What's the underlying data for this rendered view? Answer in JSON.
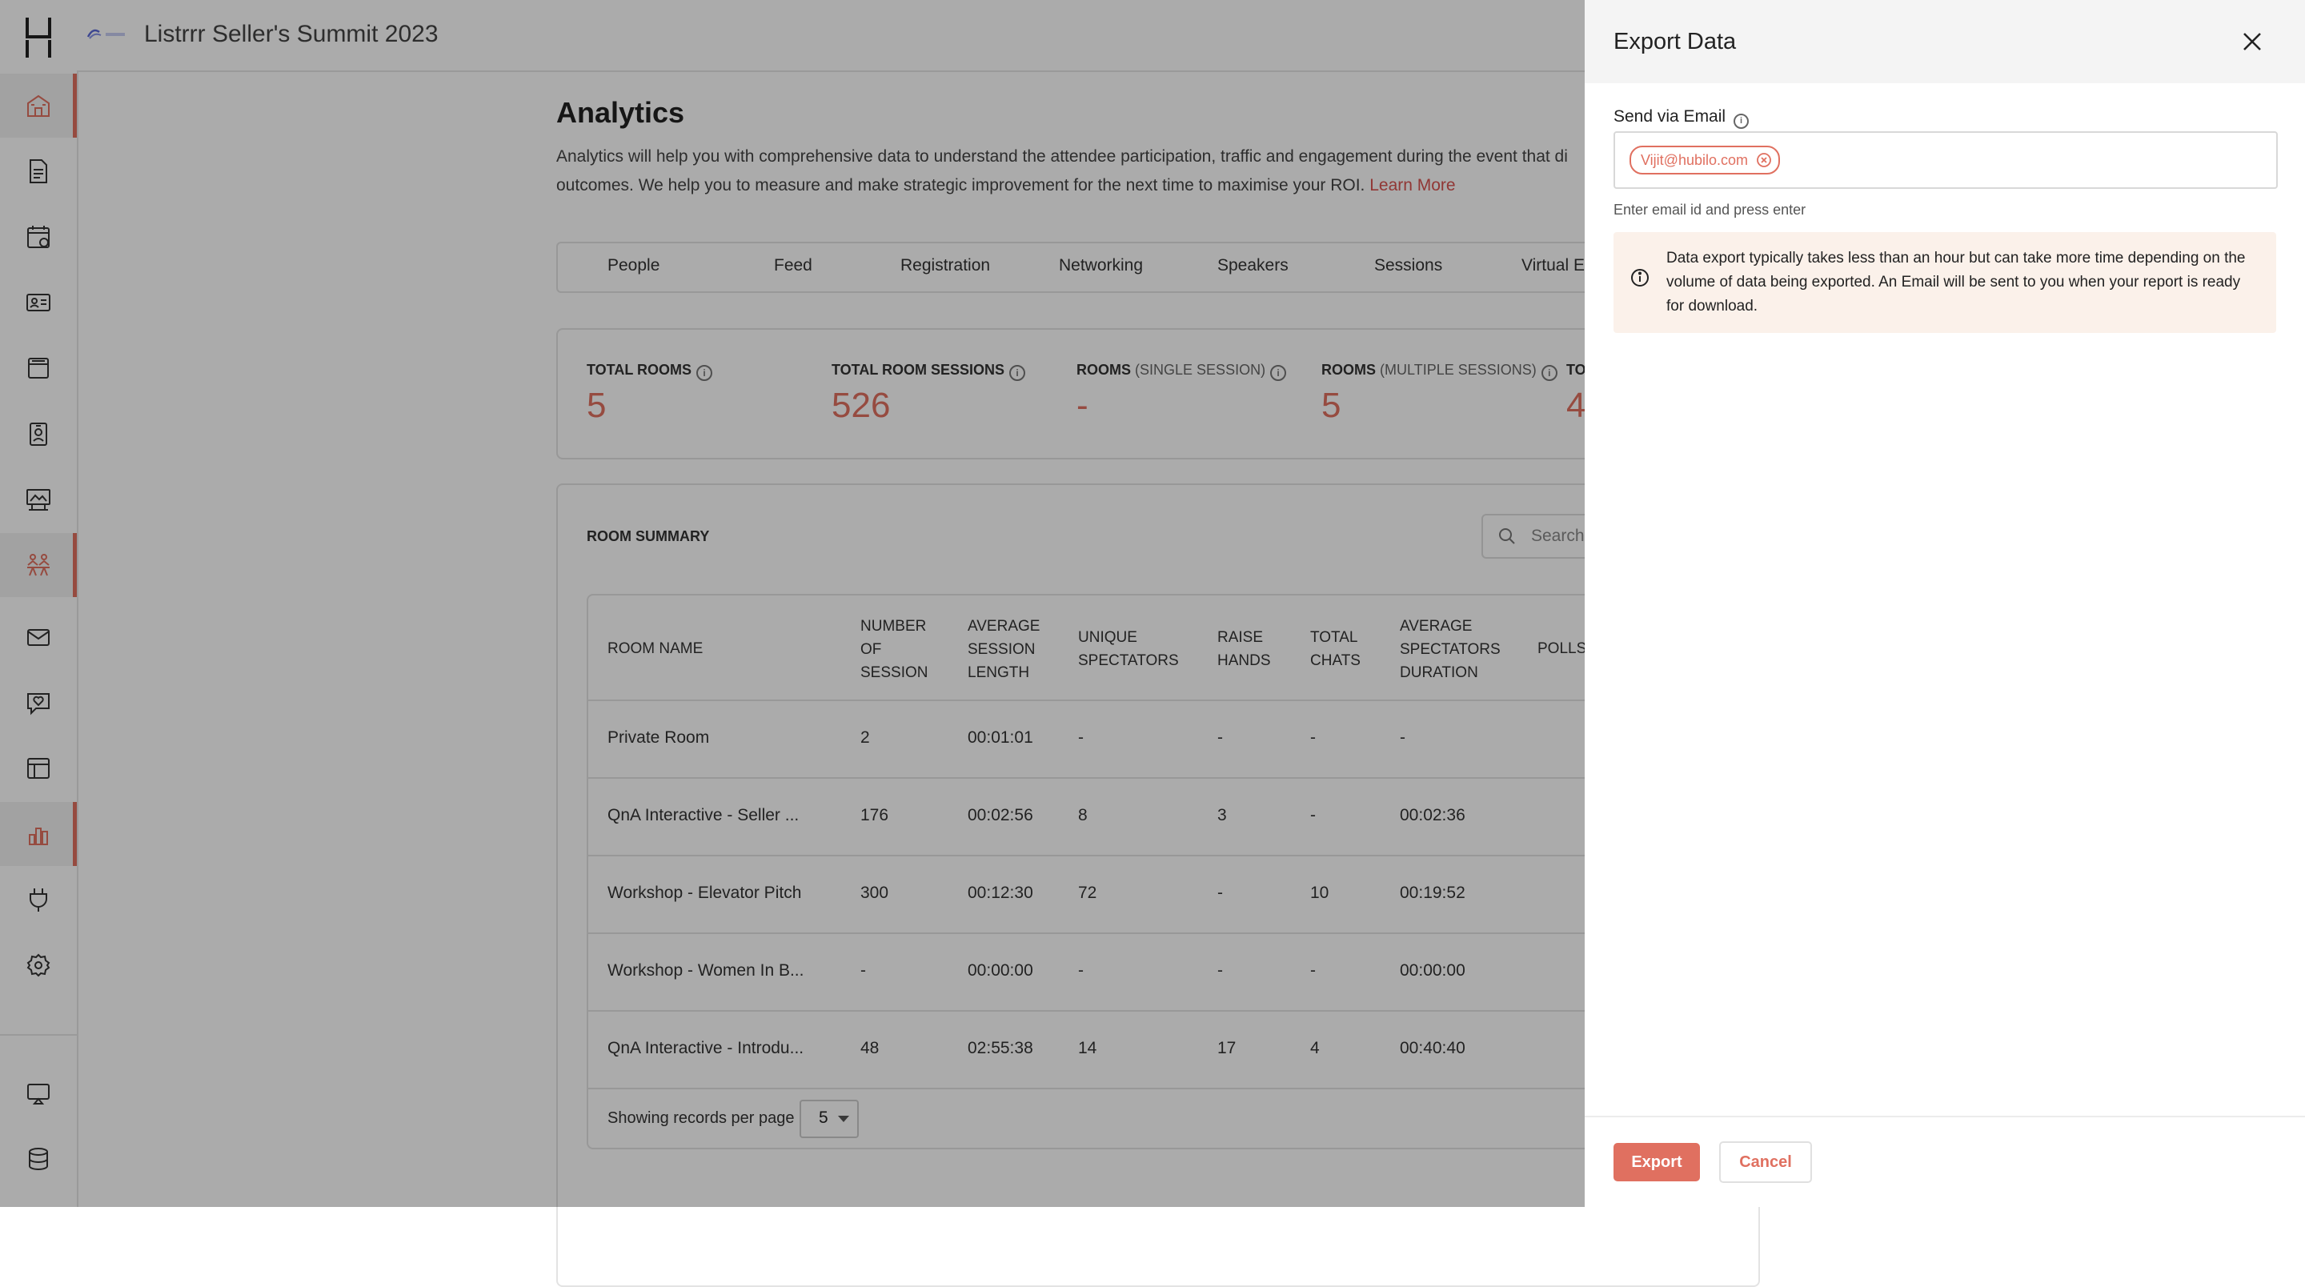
{
  "header": {
    "event_title": "Listrrr Seller's Summit 2023"
  },
  "sidebar": {
    "items": [
      {
        "icon": "home-icon",
        "active": true
      },
      {
        "icon": "document-icon",
        "active": false
      },
      {
        "icon": "calendar-icon",
        "active": false
      },
      {
        "icon": "id-card-icon",
        "active": false
      },
      {
        "icon": "booth-icon",
        "active": false
      },
      {
        "icon": "badge-icon",
        "active": false
      },
      {
        "icon": "billboard-icon",
        "active": false
      },
      {
        "icon": "networking-icon",
        "active": true
      },
      {
        "icon": "mail-icon",
        "active": false
      },
      {
        "icon": "chat-icon",
        "active": false
      },
      {
        "icon": "layout-icon",
        "active": false
      },
      {
        "icon": "analytics-icon",
        "active": true
      },
      {
        "icon": "plug-icon",
        "active": false
      },
      {
        "icon": "settings-icon",
        "active": false
      }
    ],
    "bottom": [
      {
        "icon": "present-icon"
      },
      {
        "icon": "database-icon"
      }
    ]
  },
  "page": {
    "title": "Analytics",
    "description_line1": "Analytics will help you with comprehensive data to understand the attendee participation, traffic and engagement during the event that di",
    "description_line2": "outcomes. We help you to measure and make strategic improvement for the next time to maximise your ROI.",
    "learn_more": "Learn More"
  },
  "tabs": [
    "People",
    "Feed",
    "Registration",
    "Networking",
    "Speakers",
    "Sessions",
    "Virtual E"
  ],
  "stats": [
    {
      "label": "TOTAL ROOMS",
      "sub": "",
      "value": "5"
    },
    {
      "label": "TOTAL ROOM SESSIONS",
      "sub": "",
      "value": "526"
    },
    {
      "label": "ROOMS",
      "sub": "(SINGLE SESSION)",
      "value": "-"
    },
    {
      "label": "ROOMS",
      "sub": "(MULTIPLE SESSIONS)",
      "value": "5"
    },
    {
      "label": "TO",
      "sub": "",
      "value": "4"
    }
  ],
  "room_summary": {
    "title": "ROOM SUMMARY",
    "search_placeholder": "Search",
    "columns": [
      "ROOM NAME",
      "NUMBER\nOF\nSESSION",
      "AVERAGE\nSESSION\nLENGTH",
      "UNIQUE\nSPECTATORS",
      "RAISE\nHANDS",
      "TOTAL\nCHATS",
      "AVERAGE\nSPECTATORS\nDURATION",
      "POLLS"
    ],
    "rows": [
      [
        "Private Room",
        "2",
        "00:01:01",
        "-",
        "-",
        "-",
        "-",
        "-"
      ],
      [
        "QnA Interactive - Seller ...",
        "176",
        "00:02:56",
        "8",
        "3",
        "-",
        "00:02:36",
        "-"
      ],
      [
        "Workshop - Elevator Pitch",
        "300",
        "00:12:30",
        "72",
        "-",
        "10",
        "00:19:52",
        "-"
      ],
      [
        "Workshop - Women In B...",
        "-",
        "00:00:00",
        "-",
        "-",
        "-",
        "00:00:00",
        "-"
      ],
      [
        "QnA Interactive - Introdu...",
        "48",
        "02:55:38",
        "14",
        "17",
        "4",
        "00:40:40",
        "-"
      ]
    ],
    "pager_label": "Showing records per page",
    "pager_value": "5"
  },
  "export_drawer": {
    "title": "Export Data",
    "field_label": "Send via Email",
    "email_chip": "Vijit@hubilo.com",
    "helper": "Enter email id and press enter",
    "notice": "Data export typically takes less than an hour but can take more time depending on the volume of data being exported. An Email will be sent to you when your report is ready for download.",
    "export_label": "Export",
    "cancel_label": "Cancel"
  },
  "colors": {
    "accent": "#e07060",
    "notice_bg": "#fbf1ea"
  }
}
